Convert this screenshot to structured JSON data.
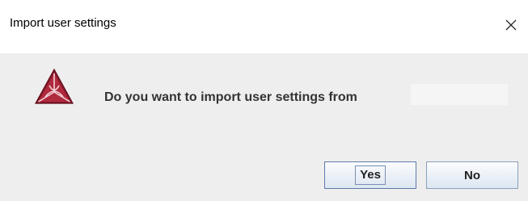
{
  "window": {
    "title": "Import user settings",
    "close_icon": "close-icon"
  },
  "dialog": {
    "icon": "thermo-calc-triangle-logo",
    "message": "Do you want to import user settings from",
    "redacted_path": ""
  },
  "buttons": {
    "yes_label": "Yes",
    "no_label": "No"
  },
  "colors": {
    "logo": "#8b1a2b",
    "content_bg": "#eeeeee",
    "title_bg": "#ffffff",
    "button_border": "#8aa0be"
  }
}
